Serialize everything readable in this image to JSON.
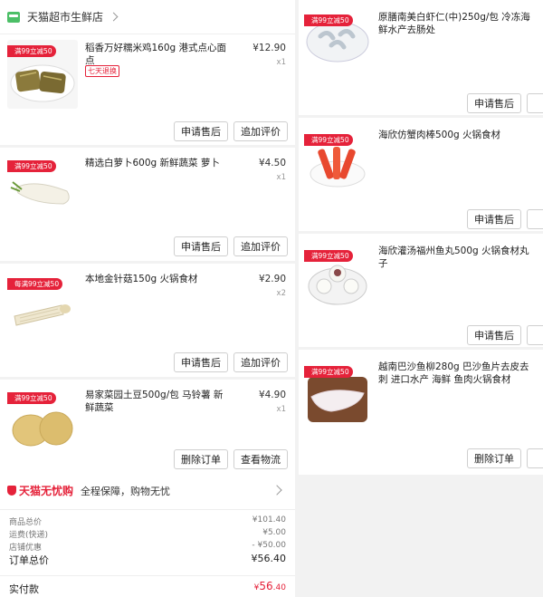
{
  "store": {
    "name": "天猫超市生鲜店"
  },
  "left_items": [
    {
      "promo": "满99立减50",
      "title": "稻香万好糯米鸡160g 港式点心面点",
      "price": "¥12.90",
      "qty": "x1",
      "tag": "七天退换",
      "btn1": "申请售后",
      "btn2": "追加评价"
    },
    {
      "promo": "满99立减50",
      "title": "精选白萝卜600g  新鲜蔬菜 萝卜",
      "price": "¥4.50",
      "qty": "x1",
      "btn1": "申请售后",
      "btn2": "追加评价"
    },
    {
      "promo": "每满99立减50",
      "title": "本地金针菇150g 火锅食材",
      "price": "¥2.90",
      "qty": "x2",
      "btn1": "申请售后",
      "btn2": "追加评价"
    },
    {
      "promo": "满99立减50",
      "title": "易家菜园土豆500g/包  马铃薯  新鲜蔬菜",
      "price": "¥4.90",
      "qty": "x1",
      "btn1": "删除订单",
      "btn2": "查看物流"
    }
  ],
  "right_items": [
    {
      "promo": "满99立减50",
      "title": "原膳南美白虾仁(中)250g/包 冷冻海鲜水产去肠处",
      "btn1": "申请售后"
    },
    {
      "promo": "满99立减50",
      "title": "海欣仿蟹肉棒500g  火锅食材",
      "btn1": "申请售后"
    },
    {
      "promo": "满99立减50",
      "title": "海欣灌汤福州鱼丸500g 火锅食材丸子",
      "btn1": "申请售后"
    },
    {
      "promo": "满99立减50",
      "title": "越南巴沙鱼柳280g 巴沙鱼片去皮去刺 进口水产 海鲜 鱼肉火锅食材",
      "btn1": "删除订单"
    }
  ],
  "guarantee": {
    "brand": "天猫无忧购",
    "text": "全程保障，购物无忧"
  },
  "summary": {
    "rows": [
      {
        "label": "商品总价",
        "value": "¥101.40"
      },
      {
        "label": "运费(快递)",
        "value": "¥5.00"
      },
      {
        "label": "店铺优惠",
        "value": "- ¥50.00"
      }
    ],
    "order_total_label": "订单总价",
    "order_total_value": "¥56.40",
    "paid_label": "实付款",
    "paid_currency": "¥",
    "paid_int": "56",
    "paid_dec": ".40"
  },
  "colors": {
    "accent": "#e5223a",
    "store_icon": "#4cbf67"
  }
}
